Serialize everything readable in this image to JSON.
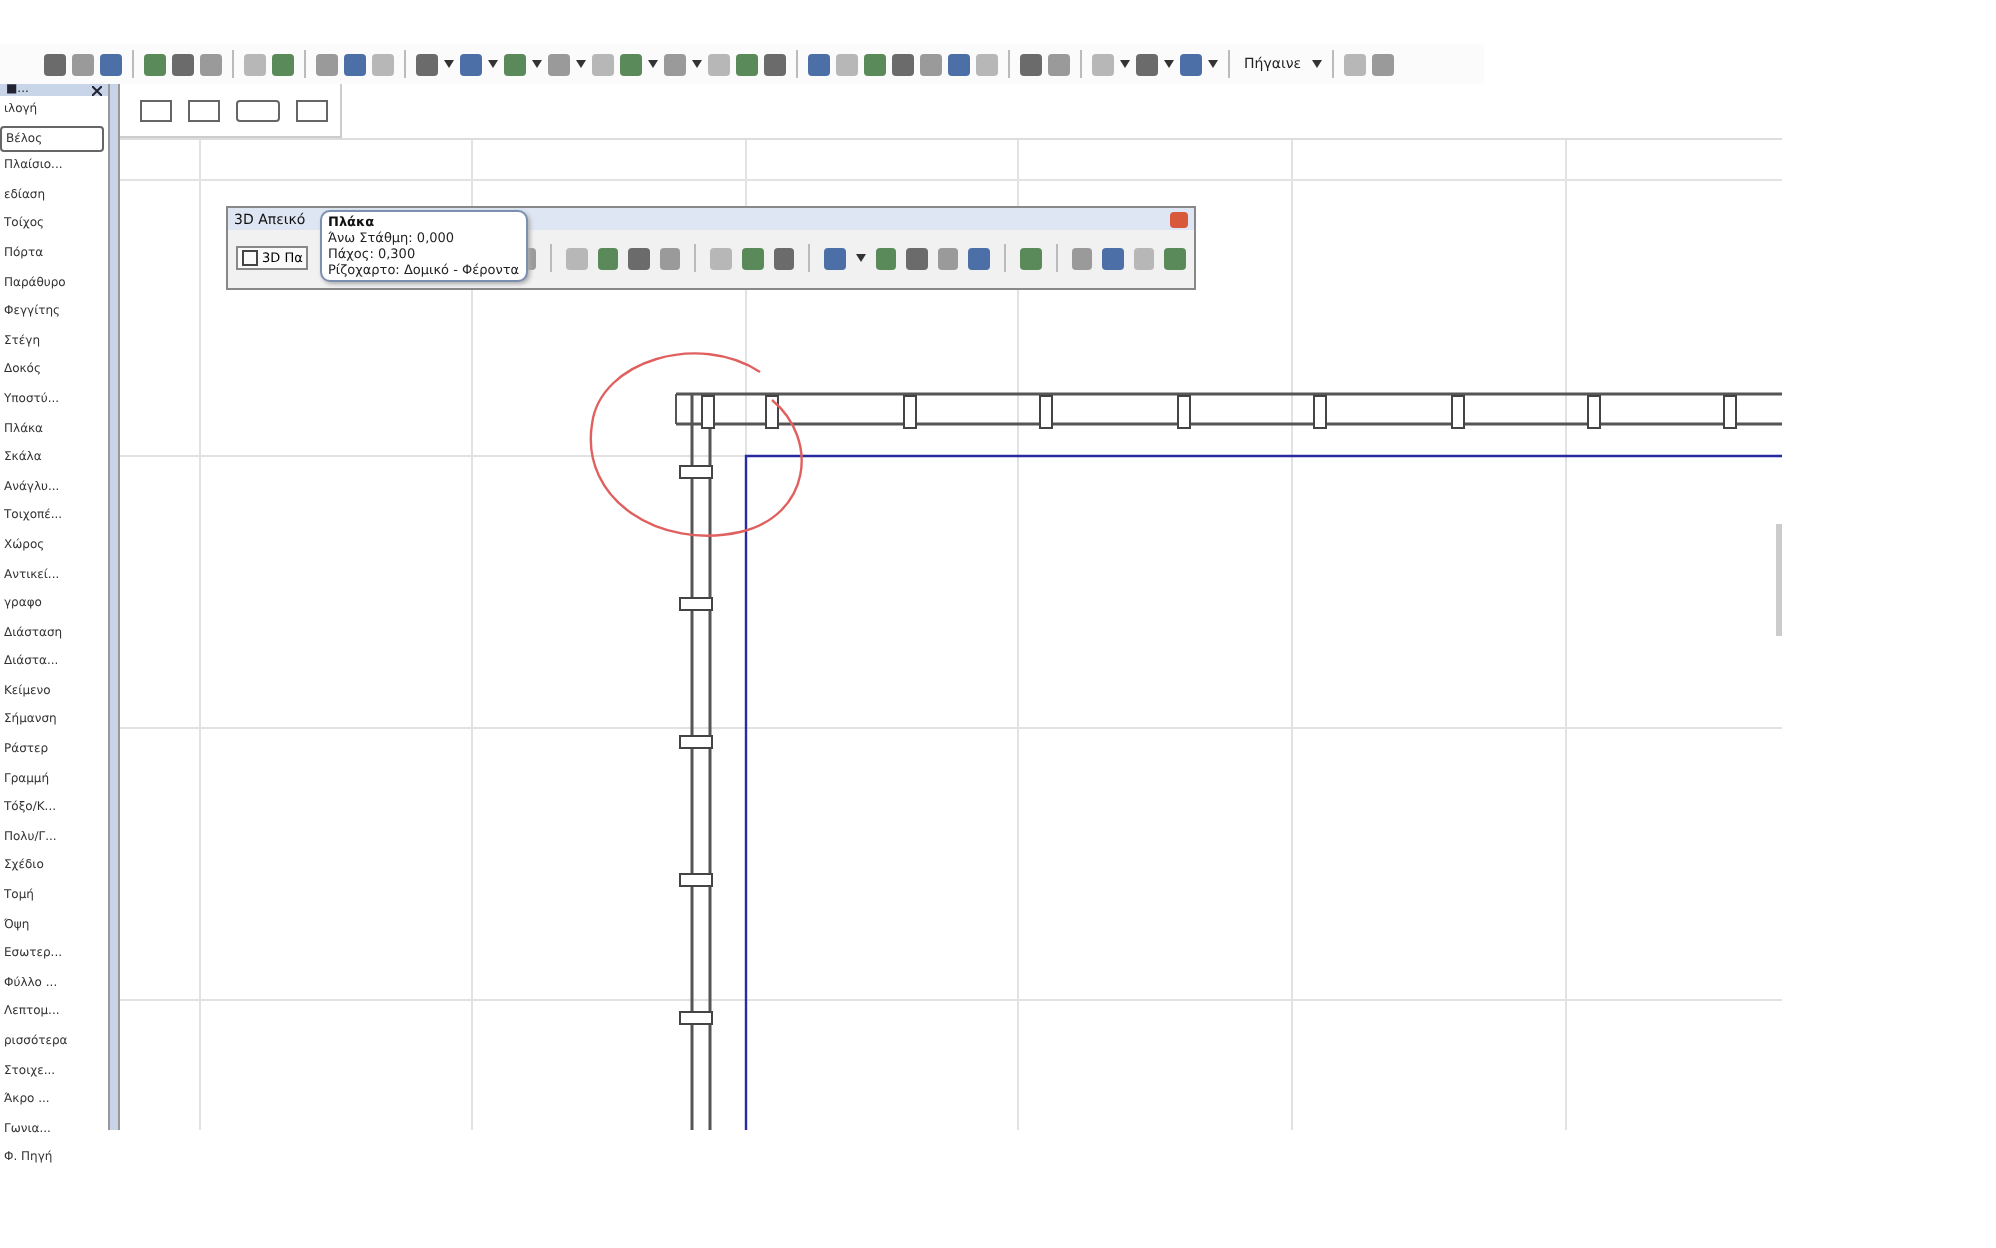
{
  "toolbar": {
    "goto_menu": "Πήγαινε"
  },
  "toolbox": {
    "header": "■...",
    "items": [
      {
        "label": "ιλογή",
        "selected": false
      },
      {
        "label": "Βέλος",
        "selected": true
      },
      {
        "label": "Πλαίσιο...",
        "selected": false
      },
      {
        "label": "εδίαση",
        "selected": false
      },
      {
        "label": "Τοίχος",
        "selected": false
      },
      {
        "label": "Πόρτα",
        "selected": false
      },
      {
        "label": "Παράθυρο",
        "selected": false
      },
      {
        "label": "Φεγγίτης",
        "selected": false
      },
      {
        "label": "Στέγη",
        "selected": false
      },
      {
        "label": "Δοκός",
        "selected": false
      },
      {
        "label": "Υποστύ...",
        "selected": false
      },
      {
        "label": "Πλάκα",
        "selected": false
      },
      {
        "label": "Σκάλα",
        "selected": false
      },
      {
        "label": "Ανάγλυ...",
        "selected": false
      },
      {
        "label": "Τοιχοπέ...",
        "selected": false
      },
      {
        "label": "Χώρος",
        "selected": false
      },
      {
        "label": "Αντικεί...",
        "selected": false
      },
      {
        "label": "γραφο",
        "selected": false
      },
      {
        "label": "Διάσταση",
        "selected": false
      },
      {
        "label": "Διάστα...",
        "selected": false
      },
      {
        "label": "Κείμενο",
        "selected": false
      },
      {
        "label": "Σήμανση",
        "selected": false
      },
      {
        "label": "Ράστερ",
        "selected": false
      },
      {
        "label": "Γραμμή",
        "selected": false
      },
      {
        "label": "Τόξο/Κ...",
        "selected": false
      },
      {
        "label": "Πολυ/Γ...",
        "selected": false
      },
      {
        "label": "Σχέδιο",
        "selected": false
      },
      {
        "label": "Τομή",
        "selected": false
      },
      {
        "label": "Όψη",
        "selected": false
      },
      {
        "label": "Εσωτερ...",
        "selected": false
      },
      {
        "label": "Φύλλο ...",
        "selected": false
      },
      {
        "label": "Λεπτομ...",
        "selected": false
      },
      {
        "label": "ρισσότερα",
        "selected": false
      },
      {
        "label": "Στοιχε...",
        "selected": false
      },
      {
        "label": "Άκρο ...",
        "selected": false
      },
      {
        "label": "Γωνια...",
        "selected": false
      },
      {
        "label": "Φ. Πηγή",
        "selected": false
      }
    ]
  },
  "palette": {
    "title": "3D Απεικό",
    "mode_button": "3D Πα"
  },
  "tooltip": {
    "title": "Πλάκα",
    "lines": [
      "Άνω Στάθμη: 0,000",
      "Πάχος: 0,300",
      "Ρίζοχαρτο: Δομικό - Φέροντα"
    ]
  }
}
